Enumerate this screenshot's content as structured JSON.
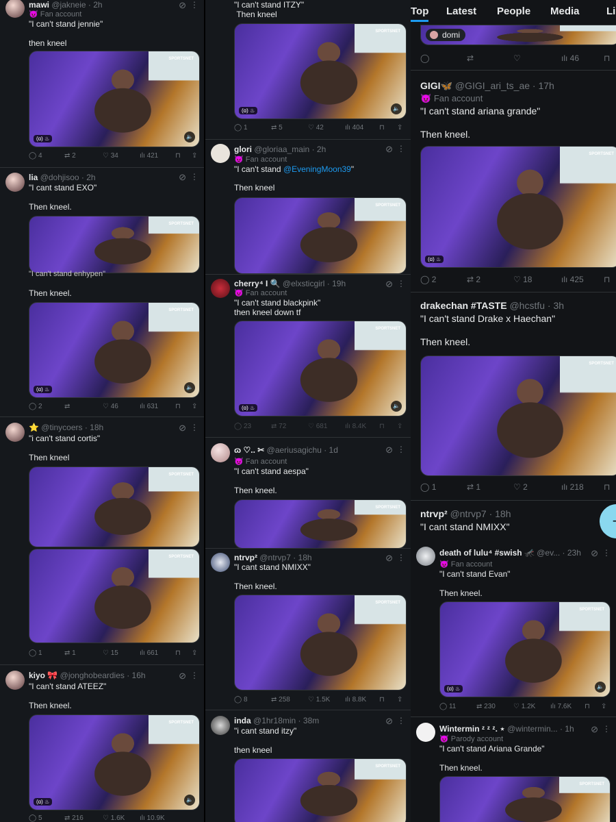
{
  "tabs": [
    "Top",
    "Latest",
    "People",
    "Media",
    "Lis"
  ],
  "pill": "domi",
  "video_logo": "SPORTSNET",
  "video_badge": "(ɑ) ♨",
  "col1": [
    {
      "name": "mawi",
      "handle": "@jakneie · 2h",
      "badge": "Fan account",
      "text": "\"I can't stand jennie\"\n\nthen kneel",
      "stats": [
        "4",
        "2",
        "34",
        "421"
      ]
    },
    {
      "name": "lia",
      "handle": "@dohjisoo · 2h",
      "badge": "",
      "text": "\"I cant stand EXO\"\n\nThen kneel.",
      "caption2": "\"I can't stand enhypen\"",
      "text2": "Then kneel.",
      "stats": [
        "2",
        "",
        "46",
        "631"
      ]
    },
    {
      "name": "⭐",
      "handle": "@tinycoers · 18h",
      "badge": "",
      "text": "\"i can't stand cortis\"\n\nThen kneel",
      "stats": [
        "1",
        "1",
        "15",
        "661"
      ]
    },
    {
      "name": "kiyo 🎀",
      "handle": "@jonghobeardies · 16h",
      "badge": "",
      "text": "\"I can't stand ATEEZ\"\n\nThen kneel.",
      "stats": [
        "5",
        "216",
        "1.6K",
        "10.9K"
      ]
    }
  ],
  "col2": [
    {
      "name": "",
      "handle": "",
      "badge": "",
      "text": "\"I can't stand ITZY\"\n Then kneel",
      "stats": [
        "1",
        "5",
        "42",
        "404"
      ]
    },
    {
      "name": "glori",
      "handle": "@gloriaa_main · 2h",
      "badge": "Fan account",
      "text_pre": "\"I can't stand ",
      "mention": "@EveningMoon39",
      "text_post": "\"",
      "text2": "Then kneel",
      "stats": [
        "",
        "",
        "",
        ""
      ]
    },
    {
      "name": "cherry⁴ I 🔍",
      "handle": "@elxsticgirl · 19h",
      "badge": "Fan account",
      "text": "\"I can't stand blackpink\"\nthen kneel down tf",
      "stats": [
        "23",
        "72",
        "681",
        "8.4K"
      ]
    },
    {
      "name": "ɷ ♡.. ✂",
      "handle": "@aeriusagichu · 1d",
      "badge": "Fan account",
      "text": "\"I can't stand aespa\"\n\nThen kneel.",
      "stats": []
    },
    {
      "name": "ntrvp²",
      "handle": "@ntrvp7 · 18h",
      "badge": "",
      "text": "\"I cant stand NMIXX\"\n\nThen kneel.",
      "stats": [
        "8",
        "258",
        "1.5K",
        "8.8K"
      ]
    },
    {
      "name": "inda",
      "handle": "@1hr18min · 38m",
      "badge": "",
      "text": "\"i cant stand itzy\"\n\nthen kneel",
      "stats": []
    }
  ],
  "col3": [
    {
      "name": "",
      "handle": "",
      "badge": "",
      "text": "",
      "stats": [
        "",
        "",
        "",
        "46"
      ]
    },
    {
      "name": "GIGI🦋",
      "handle": "@GIGI_ari_ts_ae · 17h",
      "badge": "Fan account",
      "text": "\"I can't stand ariana grande\"\n\nThen kneel.",
      "stats": [
        "2",
        "2",
        "18",
        "425"
      ]
    },
    {
      "name": "drakechan #TASTE",
      "handle": "@hcstfu · 3h",
      "badge": "",
      "text": "\"I can't stand Drake x Haechan\"\n\nThen kneel.",
      "stats": [
        "1",
        "1",
        "2",
        "218"
      ]
    },
    {
      "name": "ntrvp²",
      "handle": "@ntrvp7 · 18h",
      "badge": "",
      "text": "\"I cant stand NMIXX\"",
      "stats": []
    },
    {
      "name": "death of lulu⁴ #swish 🦟",
      "handle": "@ev... · 23h",
      "badge": "Fan account",
      "text": "\"I can't stand Evan\"\n\nThen kneel.",
      "stats": [
        "11",
        "230",
        "1.2K",
        "7.6K"
      ]
    },
    {
      "name": "Wintermin ᶻ ᶻ ᶻ. ⋆",
      "handle": "@wintermin... · 1h",
      "badge": "Parody account",
      "text": "\"I can't stand Ariana Grande\"\n\nThen kneel.",
      "stats": []
    }
  ]
}
